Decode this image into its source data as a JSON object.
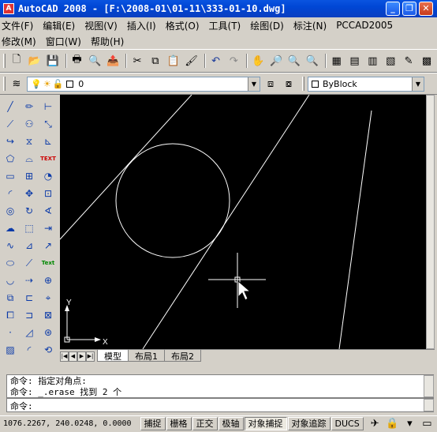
{
  "window": {
    "title": "AutoCAD 2008 - [F:\\2008-01\\01-11\\333-01-10.dwg]",
    "icon_label": "A"
  },
  "menu": {
    "row1": [
      "文件(F)",
      "编辑(E)",
      "视图(V)",
      "插入(I)",
      "格式(O)",
      "工具(T)",
      "绘图(D)",
      "标注(N)",
      "PCCAD2005"
    ],
    "row2": [
      "修改(M)",
      "窗口(W)",
      "帮助(H)"
    ]
  },
  "layer": {
    "current": "0"
  },
  "properties": {
    "color": "ByBlock"
  },
  "drawing": {
    "ucs": {
      "x_label": "X",
      "y_label": "Y"
    }
  },
  "tabs": [
    {
      "label": "模型",
      "active": true
    },
    {
      "label": "布局1",
      "active": false
    },
    {
      "label": "布局2",
      "active": false
    }
  ],
  "command": {
    "history": [
      "命令: 指定对角点:",
      "命令: _.erase 找到 2 个"
    ],
    "prompt": "命令:"
  },
  "status": {
    "coords": "1076.2267, 240.0248, 0.0000",
    "toggles": [
      {
        "label": "捕捉",
        "on": false
      },
      {
        "label": "栅格",
        "on": false
      },
      {
        "label": "正交",
        "on": false
      },
      {
        "label": "极轴",
        "on": false
      },
      {
        "label": "对象捕捉",
        "on": true
      },
      {
        "label": "对象追踪",
        "on": false
      },
      {
        "label": "DUCS",
        "on": false
      }
    ]
  },
  "colors": {
    "canvas": "#000000",
    "title": "#0054e3",
    "entity": "#ffffff"
  }
}
